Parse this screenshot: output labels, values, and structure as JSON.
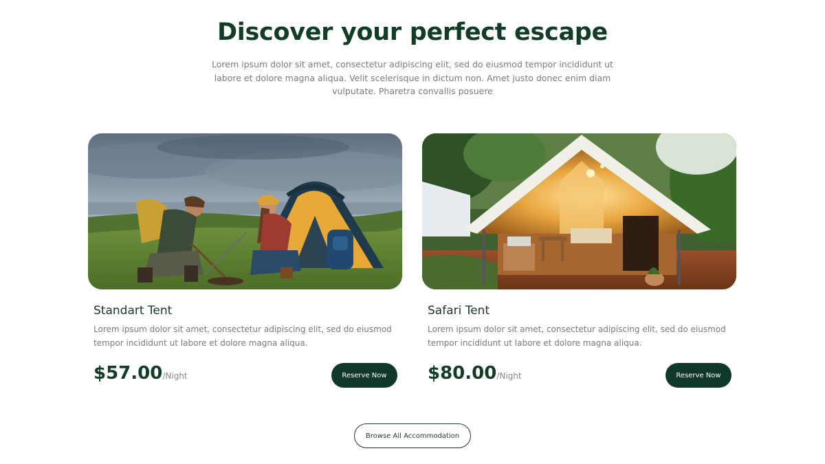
{
  "section": {
    "title": "Discover your perfect escape",
    "intro": "Lorem ipsum dolor sit amet, consectetur adipiscing elit, sed do eiusmod tempor incididunt ut labore et dolore magna aliqua. Velit scelerisque in dictum non. Amet justo donec enim diam vulputate. Pharetra convallis posuere"
  },
  "cards": [
    {
      "title": "Standart Tent",
      "description": "Lorem ipsum dolor sit amet, consectetur adipiscing elit, sed do eiusmod tempor incididunt ut labore et dolore magna aliqua.",
      "price": "$57.00",
      "unit": "/Night",
      "button": "Reserve Now"
    },
    {
      "title": "Safari Tent",
      "description": "Lorem ipsum dolor sit amet, consectetur adipiscing elit, sed do eiusmod tempor incididunt ut labore et dolore magna aliqua.",
      "price": "$80.00",
      "unit": "/Night",
      "button": "Reserve Now"
    }
  ],
  "browse_button": "Browse All Accommodation",
  "colors": {
    "brand_dark_green": "#103828",
    "heading_green": "#123c28",
    "body_text_gray": "#7a7a7a"
  }
}
